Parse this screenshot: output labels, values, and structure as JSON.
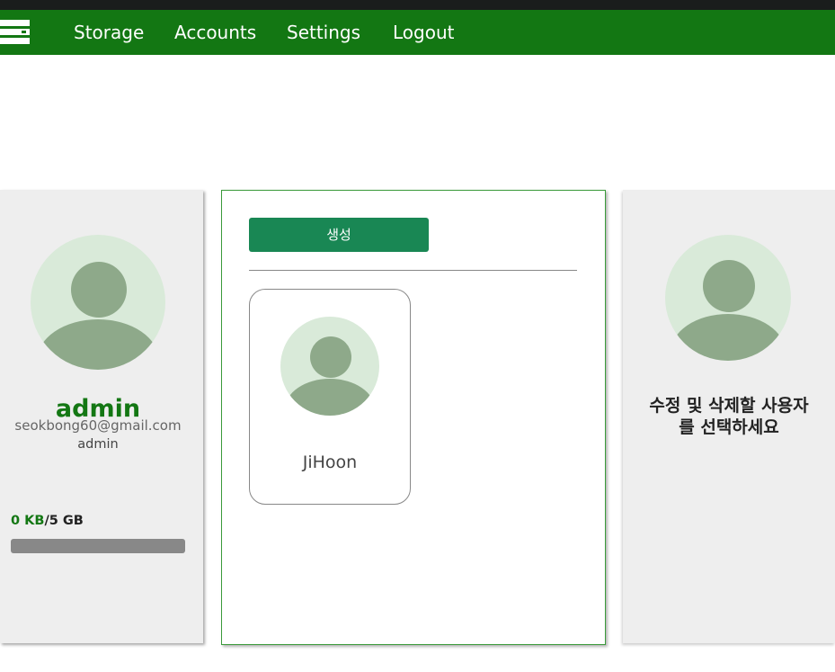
{
  "nav": {
    "menu_icon": "menu-icon",
    "items": [
      "Storage",
      "Accounts",
      "Settings",
      "Logout"
    ]
  },
  "profile": {
    "username": "admin",
    "email": "seokbong60@gmail.com",
    "role": "admin",
    "storage_used": "0 KB",
    "storage_total": "/5 GB",
    "storage_fraction": 0
  },
  "accounts": {
    "create_label": "생성",
    "users": [
      {
        "name": "JiHoon"
      }
    ]
  },
  "detail": {
    "line1": "수정 및 삭제할 사용자",
    "line2": "를 선택하세요"
  },
  "colors": {
    "nav_bg": "#137713",
    "accent_green": "#137713",
    "button_green": "#198754",
    "avatar_bg": "#d9ead9",
    "avatar_fg": "#8ea98a"
  }
}
